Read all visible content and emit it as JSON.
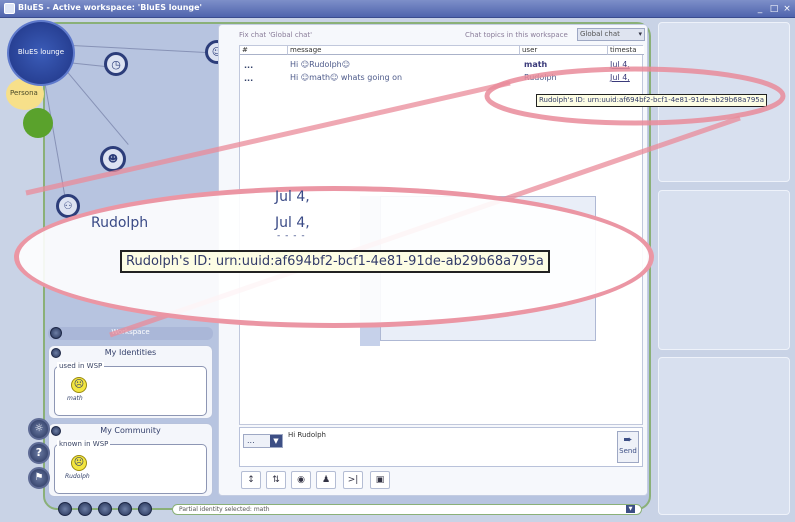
{
  "window": {
    "title": "BluES - Active workspace: 'BluES lounge'",
    "minimize": "_",
    "maximize": "□",
    "close": "×"
  },
  "bubbles": {
    "lounge_label": "BluES lounge",
    "personal_label": "Persona"
  },
  "chat": {
    "fix_label": "Fix chat 'Global chat'",
    "topics_label": "Chat topics in this workspace",
    "topic_selected": "Global chat",
    "columns": [
      "#",
      "message",
      "user",
      "timesta"
    ],
    "rows": [
      {
        "num": "...",
        "message": "Hi ☺Rudolph☺",
        "user": "math",
        "time": "Jul 4,"
      },
      {
        "num": "...",
        "message": "Hi ☺math☺ whats going on",
        "user": "Rudolph",
        "time": "Jul 4,"
      }
    ],
    "tooltip": "Rudolph's ID: urn:uuid:af694bf2-bcf1-4e81-91de-ab29b68a795a",
    "input_value": "Hi Rudolph",
    "send_label": "Send",
    "dropdown_label": "..."
  },
  "zoom": {
    "user": "Rudolph",
    "time1": "Jul 4,",
    "time2": "Jul 4,",
    "dashes": "- - - -",
    "tooltip": "Rudolph's ID: urn:uuid:af694bf2-bcf1-4e81-91de-ab29b68a795a"
  },
  "left": {
    "workspace_label": "Workspace",
    "identities_title": "My Identities",
    "identities_legend": "used in WSP",
    "identity_name": "math",
    "community_title": "My Community",
    "community_legend": "known in WSP",
    "community_name": "Rudolph",
    "help_label": "?"
  },
  "bottom": {
    "identity_selected": "Partial identity selected: math"
  },
  "colors": {
    "frame_green": "#8ab078",
    "title_blue": "#4f64ad",
    "lounge_blue": "#2e4aa0",
    "personal_yellow": "#f7e08a",
    "green_dot": "#5aa22c",
    "highlight": "#e98b9a"
  }
}
